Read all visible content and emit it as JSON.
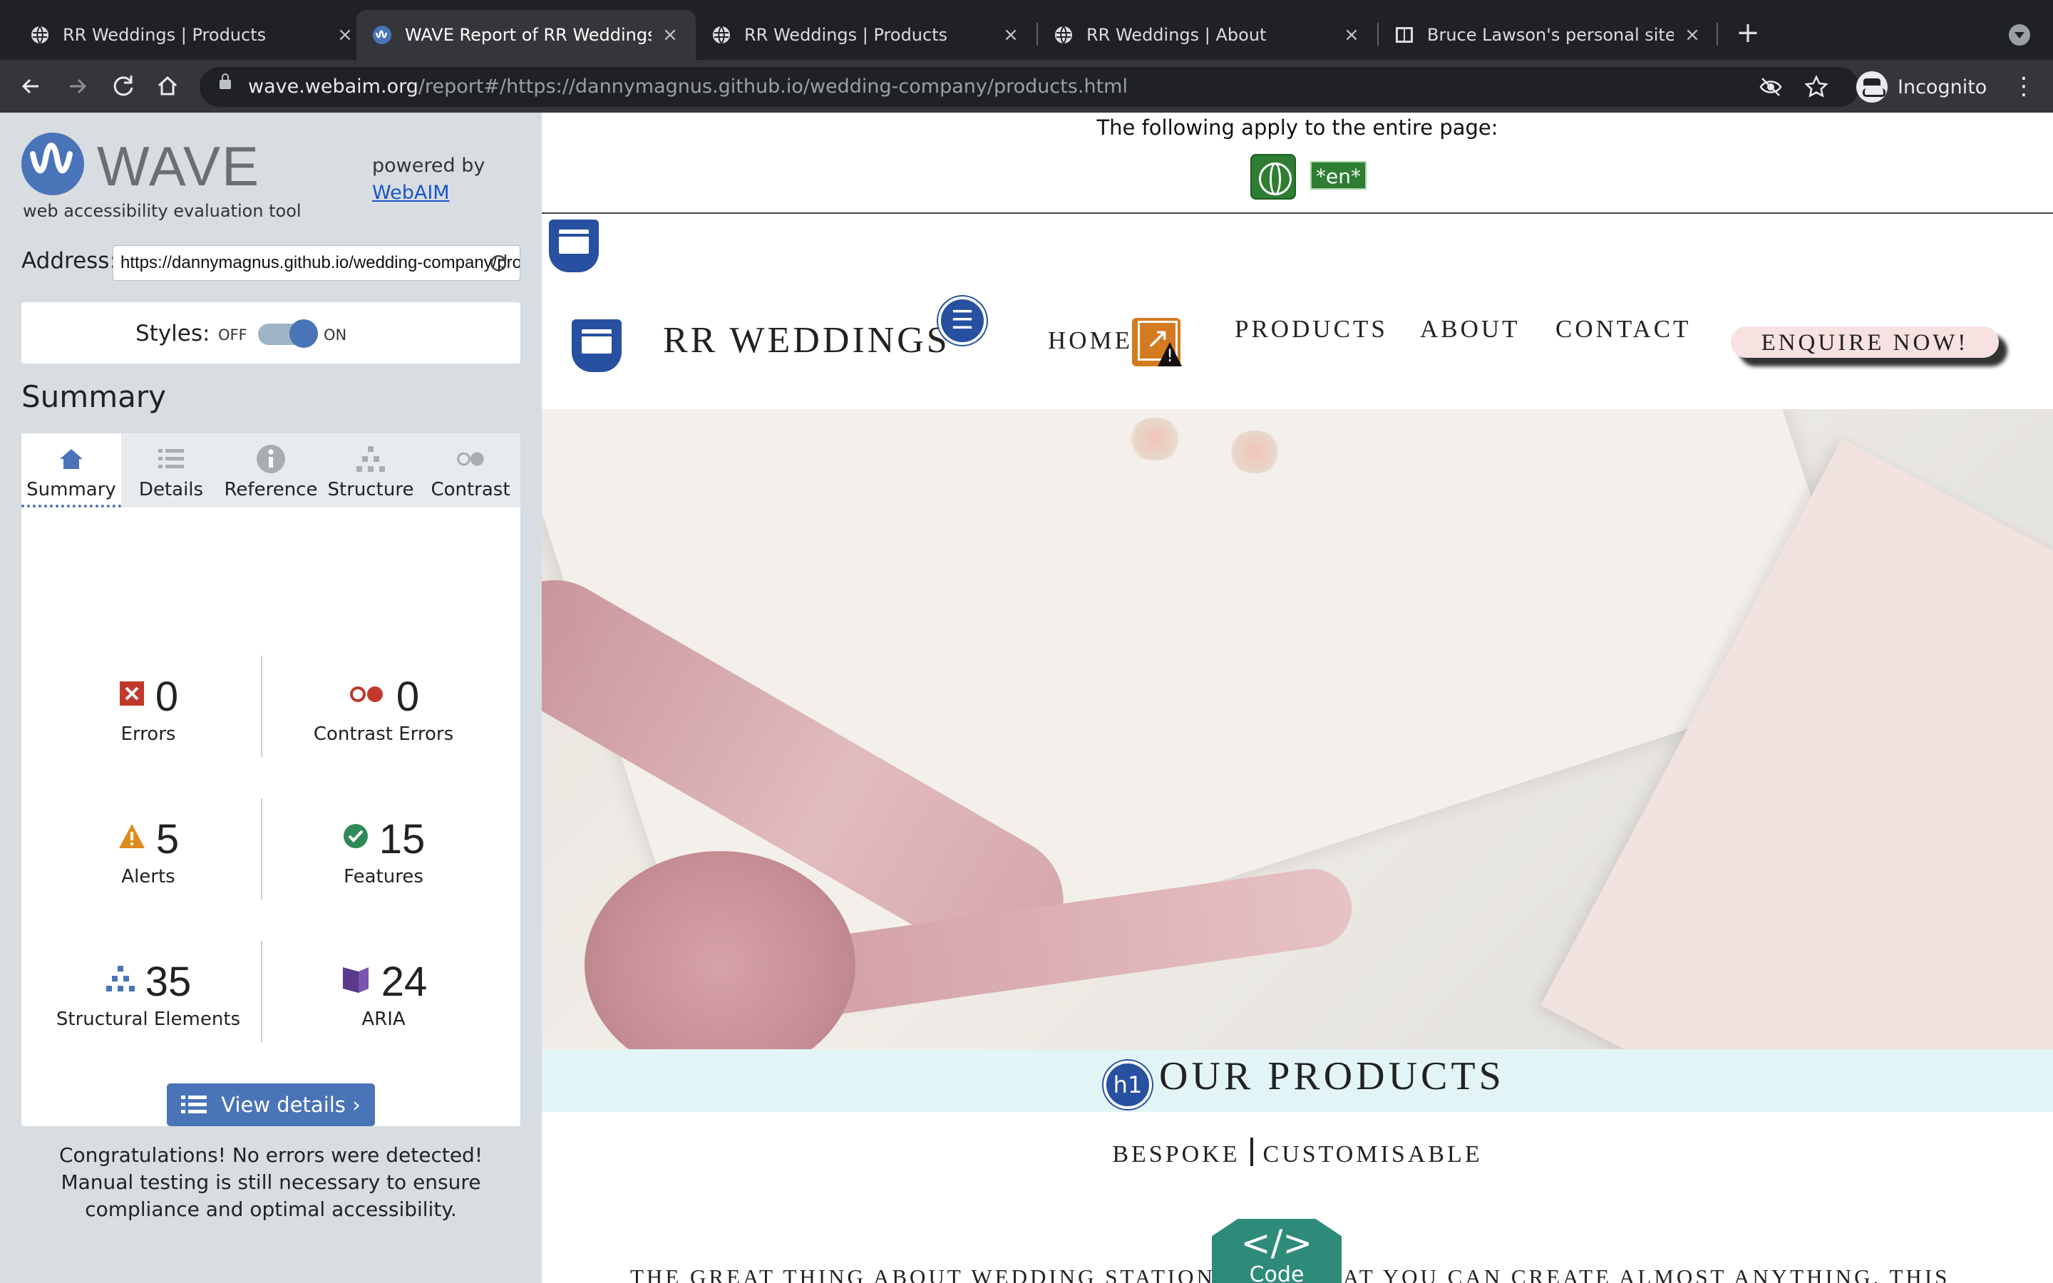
{
  "browser": {
    "tabs": [
      {
        "title": "RR Weddings | Products",
        "active": false
      },
      {
        "title": "WAVE Report of RR Weddings | Pro",
        "active": true
      },
      {
        "title": "RR Weddings | Products",
        "active": false
      },
      {
        "title": "RR Weddings | About",
        "active": false
      },
      {
        "title": "Bruce Lawson's personal site",
        "active": false
      }
    ],
    "close_glyph": "×",
    "new_tab_glyph": "+",
    "url_host": "wave.webaim.org",
    "url_path": "/report#/https://dannymagnus.github.io/wedding-company/products.html",
    "profile_label": "Incognito"
  },
  "wave": {
    "name": "WAVE",
    "tagline": "web accessibility evaluation tool",
    "powered_by": "powered by",
    "powered_link": "WebAIM",
    "address_label": "Address:",
    "address_value": "https://dannymagnus.github.io/wedding-company/products.html",
    "styles_label": "Styles:",
    "styles_off": "OFF",
    "styles_on": "ON",
    "summary_heading": "Summary",
    "tabs": [
      {
        "label": "Summary",
        "icon": "home-icon"
      },
      {
        "label": "Details",
        "icon": "list-icon"
      },
      {
        "label": "Reference",
        "icon": "info-icon"
      },
      {
        "label": "Structure",
        "icon": "hierarchy-icon"
      },
      {
        "label": "Contrast",
        "icon": "contrast-icon"
      }
    ],
    "stats": {
      "errors": {
        "value": "0",
        "label": "Errors"
      },
      "contrast_errors": {
        "value": "0",
        "label": "Contrast Errors"
      },
      "alerts": {
        "value": "5",
        "label": "Alerts"
      },
      "features": {
        "value": "15",
        "label": "Features"
      },
      "structural": {
        "value": "35",
        "label": "Structural Elements"
      },
      "aria": {
        "value": "24",
        "label": "ARIA"
      }
    },
    "view_details": "View details ›",
    "congrats": "Congratulations! No errors were detected! Manual testing is still necessary to ensure compliance and optimal accessibility.",
    "colors": {
      "accent": "#4a74b8",
      "error": "#c0392b",
      "alert": "#e08a1e",
      "feature": "#2e8b57",
      "aria": "#5b3a8c"
    }
  },
  "page": {
    "apply_text": "The following apply to the entire page:",
    "lang_badge": "*en*",
    "brand": "RR WEDDINGS",
    "nav": {
      "home": "HOME",
      "products": "PRODUCTS",
      "about": "ABOUT",
      "contact": "CONTACT"
    },
    "enquire": "ENQUIRE NOW!",
    "h1_badge": "h1",
    "products_title": "OUR PRODUCTS",
    "subtitle_left": "BESPOKE",
    "subtitle_right": "CUSTOMISABLE",
    "body_text": "THE GREAT THING ABOUT WEDDING STATIONERY IS THAT YOU CAN CREATE ALMOST ANYTHING. THIS",
    "code_glyph": "</>",
    "code_label": "Code"
  }
}
